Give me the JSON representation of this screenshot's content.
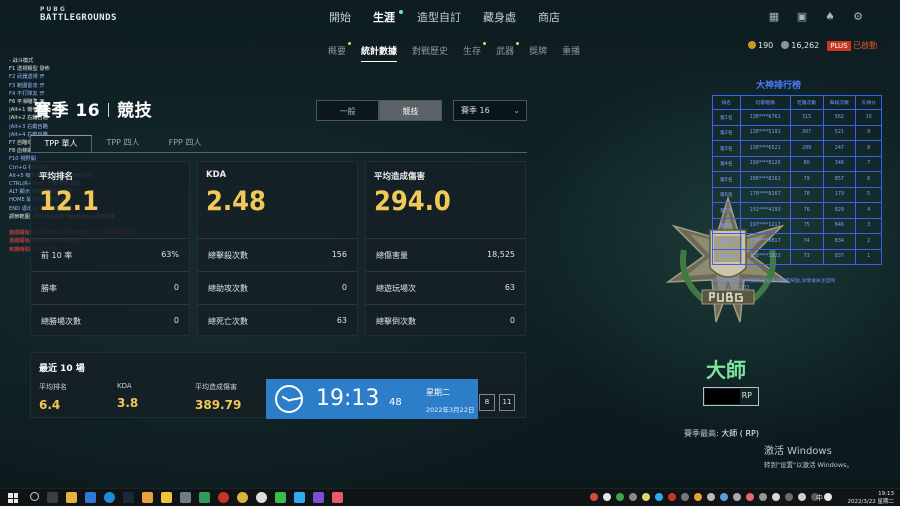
{
  "topbar": {
    "logo_line1": "PUBG",
    "logo_line2": "BATTLEGROUNDS",
    "nav": [
      {
        "label": "開始"
      },
      {
        "label": "生涯",
        "active": true
      },
      {
        "label": "造型自訂"
      },
      {
        "label": "藏身處"
      },
      {
        "label": "商店"
      }
    ],
    "icons": [
      "shop-icon",
      "news-icon",
      "notification-bell-icon",
      "gear-icon"
    ]
  },
  "subnav": [
    {
      "label": "概要"
    },
    {
      "label": "統計數據",
      "active": true
    },
    {
      "label": "對戰歷史"
    },
    {
      "label": "生存"
    },
    {
      "label": "武器"
    },
    {
      "label": "獎牌"
    },
    {
      "label": "重播"
    }
  ],
  "currency": {
    "g_coin": "190",
    "bp": "16,262",
    "plus_label": "PLUS",
    "plus_status": "已啟動"
  },
  "overlay_menu": [
    {
      "text": "- 战斗模式",
      "c": "w"
    },
    {
      "text": "F1 透視類型      發佈",
      "c": "w"
    },
    {
      "text": "F2 武器透視      开",
      "c": "b"
    },
    {
      "text": "F3 範圍雷達      开",
      "c": "b"
    },
    {
      "text": "F4 不打隊友      开",
      "c": "b"
    },
    {
      "text": "F6 平滑瞄準      开",
      "c": "w"
    },
    {
      "text": "  |Alt+1  機甲瞄準 - 心臟",
      "c": "w"
    },
    {
      "text": "  |Alt+2  右鍵自瞄",
      "c": "w"
    },
    {
      "text": "  |Alt+3  右鍵自瞄",
      "c": "b"
    },
    {
      "text": "  |Alt+4  右鍵自瞄",
      "c": "b"
    },
    {
      "text": "F7 自瞄增強",
      "c": "w"
    },
    {
      "text": "F8 血條顯示",
      "c": "w"
    },
    {
      "text": "F10 視野開",
      "c": "b"
    },
    {
      "text": "Ctrl+G 視野距離",
      "c": "b"
    },
    {
      "text": "Alt+5 吸附範圍設置 (滑鼠滾輪调整)",
      "c": "b"
    },
    {
      "text": "CTRL(R+Shift) 方框骨架 開啟",
      "c": "b"
    },
    {
      "text": "ALT 顯示/隱藏所有物品透視",
      "c": "b"
    },
    {
      "text": "HOME 開啟/隱藏菜單 顯示",
      "c": "b"
    },
    {
      "text": "END 退出程序 - 隱藏菜單",
      "c": "b"
    },
    {
      "text": "調節範圍: 100 PageUP PageDown 調節範圍",
      "c": "w"
    },
    {
      "text": "",
      "c": "w"
    },
    {
      "text": "遊戲開始前請開啟輔助,否則會被封號--天,本輔助不管理!",
      "c": "r"
    },
    {
      "text": "遊戲開始前請關閉所有無關程序",
      "c": "r"
    },
    {
      "text": "到期時間: 2022年後",
      "c": "r"
    }
  ],
  "season_title": {
    "season": "賽季 16",
    "mode": "競技"
  },
  "mode_toggle": {
    "options": [
      "一般",
      "競技"
    ],
    "active": 1
  },
  "season_select": {
    "value": "賽季 16"
  },
  "tabs": [
    {
      "label": "TPP 單人",
      "active": true
    },
    {
      "label": "TPP 四人"
    },
    {
      "label": "FPP 四人"
    }
  ],
  "cards": [
    {
      "title": "平均排名",
      "big": "12.1",
      "rows": [
        {
          "label": "前 10 率",
          "value": "63%"
        },
        {
          "label": "勝率",
          "value": "0"
        },
        {
          "label": "總勝場次數",
          "value": "0"
        }
      ]
    },
    {
      "title": "KDA",
      "big": "2.48",
      "rows": [
        {
          "label": "總擊殺次數",
          "value": "156"
        },
        {
          "label": "總助攻次數",
          "value": "0"
        },
        {
          "label": "總死亡次數",
          "value": "63"
        }
      ]
    },
    {
      "title": "平均造成傷害",
      "big": "294.0",
      "rows": [
        {
          "label": "總傷害量",
          "value": "18,525"
        },
        {
          "label": "總遊玩場次",
          "value": "63"
        },
        {
          "label": "總擊倒次數",
          "value": "0"
        }
      ]
    }
  ],
  "recent": {
    "title": "最近 10 場",
    "cols": [
      {
        "label": "平均排名",
        "value": "6.4"
      },
      {
        "label": "KDA",
        "value": "3.8"
      },
      {
        "label": "平均造成傷害",
        "value": "389.79"
      }
    ],
    "pager": [
      "8",
      "11"
    ]
  },
  "clock_widget": {
    "time": "19:13",
    "seconds": "48",
    "weekday": "星期二",
    "date": "2022年3月22日"
  },
  "leaderboard": {
    "title": "大神排行榜",
    "headers": [
      "排名",
      "玩家暱稱",
      "吃雞次數",
      "擊殺次數",
      "天梯分"
    ],
    "rows": [
      [
        "第1名",
        "138****6761",
        "315",
        "562",
        "10"
      ],
      [
        "第2名",
        "138****5191",
        "307",
        "521",
        "9"
      ],
      [
        "第3名",
        "138****6521",
        "289",
        "247",
        "8"
      ],
      [
        "第4名",
        "199****8120",
        "80",
        "346",
        "7"
      ],
      [
        "第5名",
        "188****8161",
        "79",
        "857",
        "6"
      ],
      [
        "第6名",
        "178****8167",
        "78",
        "179",
        "5"
      ],
      [
        "第7名",
        "151****4193",
        "76",
        "829",
        "4"
      ],
      [
        "第8名",
        "197****1217",
        "75",
        "846",
        "3"
      ],
      [
        "第9名",
        "158****8817",
        "74",
        "834",
        "2"
      ],
      [
        "第10名",
        "188****1823",
        "73",
        "837",
        "1"
      ]
    ],
    "foot": [
      "排行榜每日更新,完成指定任务可获得奖励,详情请关注官网",
      "ID: 7635 | 3233"
    ]
  },
  "rank": {
    "tier": "大師",
    "rp_label": "RP",
    "season_high_label": "賽季最高:",
    "season_high_value": "大師 (      RP)"
  },
  "windows_watermark": {
    "line1": "激活 Windows",
    "line2": "转到\"设置\"以激活 Windows。"
  },
  "taskbar": {
    "ime": "中",
    "time": "19:13",
    "date": "2022/3/22 星期二"
  }
}
